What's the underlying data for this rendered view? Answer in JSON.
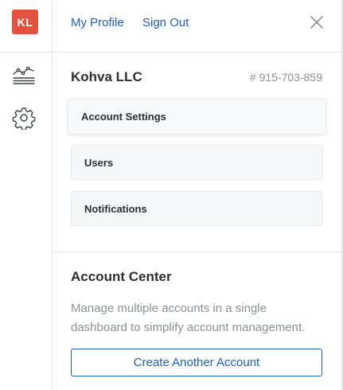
{
  "user": {
    "initials": "KL"
  },
  "header": {
    "my_profile": "My Profile",
    "sign_out": "Sign Out"
  },
  "account": {
    "name": "Kohva LLC",
    "number": "# 915-703-859"
  },
  "menu": [
    {
      "label": "Account Settings",
      "active": true
    },
    {
      "label": "Users",
      "active": false
    },
    {
      "label": "Notifications",
      "active": false
    }
  ],
  "account_center": {
    "title": "Account Center",
    "description": "Manage multiple accounts in a single dashboard to simplify account management.",
    "button_label": "Create Another Account"
  },
  "icons": {
    "rail": [
      "chart-line-icon",
      "settings-gear-icon"
    ],
    "close": "close-icon"
  },
  "colors": {
    "avatar": "#e4523f",
    "link": "#1d5fb8",
    "text": "#2b2f33",
    "muted": "#8a9097"
  }
}
